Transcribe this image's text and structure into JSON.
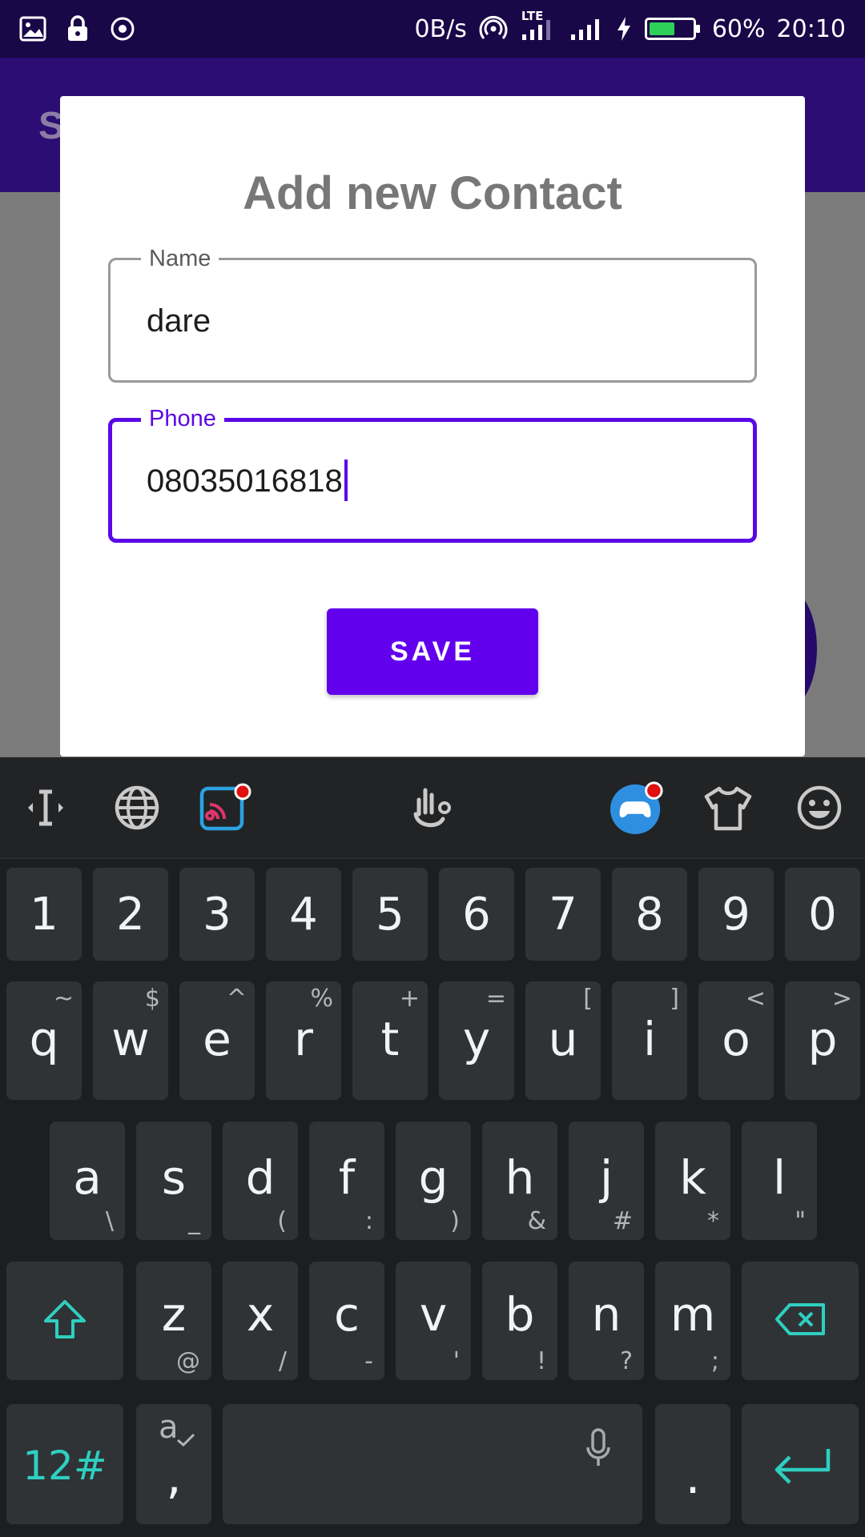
{
  "status_bar": {
    "speed": "0B/s",
    "network": "LTE",
    "battery_percent_text": "60%",
    "battery_level": 0.6,
    "time": "20:10"
  },
  "app": {
    "title_partial": "S"
  },
  "dialog": {
    "title": "Add new Contact",
    "name_field": {
      "label": "Name",
      "value": "dare"
    },
    "phone_field": {
      "label": "Phone",
      "value": "08035016818"
    },
    "save_label": "SAVE"
  },
  "keyboard": {
    "number_row": [
      "1",
      "2",
      "3",
      "4",
      "5",
      "6",
      "7",
      "8",
      "9",
      "0"
    ],
    "row_qwerty": [
      {
        "key": "q",
        "hint": "~"
      },
      {
        "key": "w",
        "hint": "$"
      },
      {
        "key": "e",
        "hint": "^"
      },
      {
        "key": "r",
        "hint": "%"
      },
      {
        "key": "t",
        "hint": "+"
      },
      {
        "key": "y",
        "hint": "="
      },
      {
        "key": "u",
        "hint": "["
      },
      {
        "key": "i",
        "hint": "]"
      },
      {
        "key": "o",
        "hint": "<"
      },
      {
        "key": "p",
        "hint": ">"
      }
    ],
    "row_asdf": [
      {
        "key": "a",
        "hint": "\\"
      },
      {
        "key": "s",
        "hint": "_"
      },
      {
        "key": "d",
        "hint": "("
      },
      {
        "key": "f",
        "hint": ":"
      },
      {
        "key": "g",
        "hint": ")"
      },
      {
        "key": "h",
        "hint": "&"
      },
      {
        "key": "j",
        "hint": "#"
      },
      {
        "key": "k",
        "hint": "*"
      },
      {
        "key": "l",
        "hint": "\""
      }
    ],
    "row_zxcv": [
      {
        "key": "z",
        "hint": "@"
      },
      {
        "key": "x",
        "hint": "/"
      },
      {
        "key": "c",
        "hint": "-"
      },
      {
        "key": "v",
        "hint": "'"
      },
      {
        "key": "b",
        "hint": "!"
      },
      {
        "key": "n",
        "hint": "?"
      },
      {
        "key": "m",
        "hint": ";"
      }
    ],
    "symbols_label": "12#",
    "comma_key": ",",
    "comma_hint": "a",
    "period_key": ".",
    "accent_color": "#2fcfc0"
  },
  "colors": {
    "primary": "#6200ee",
    "status_bar": "#190748",
    "keyboard_bg": "#1d1e20",
    "key_bg": "#2f3336"
  }
}
